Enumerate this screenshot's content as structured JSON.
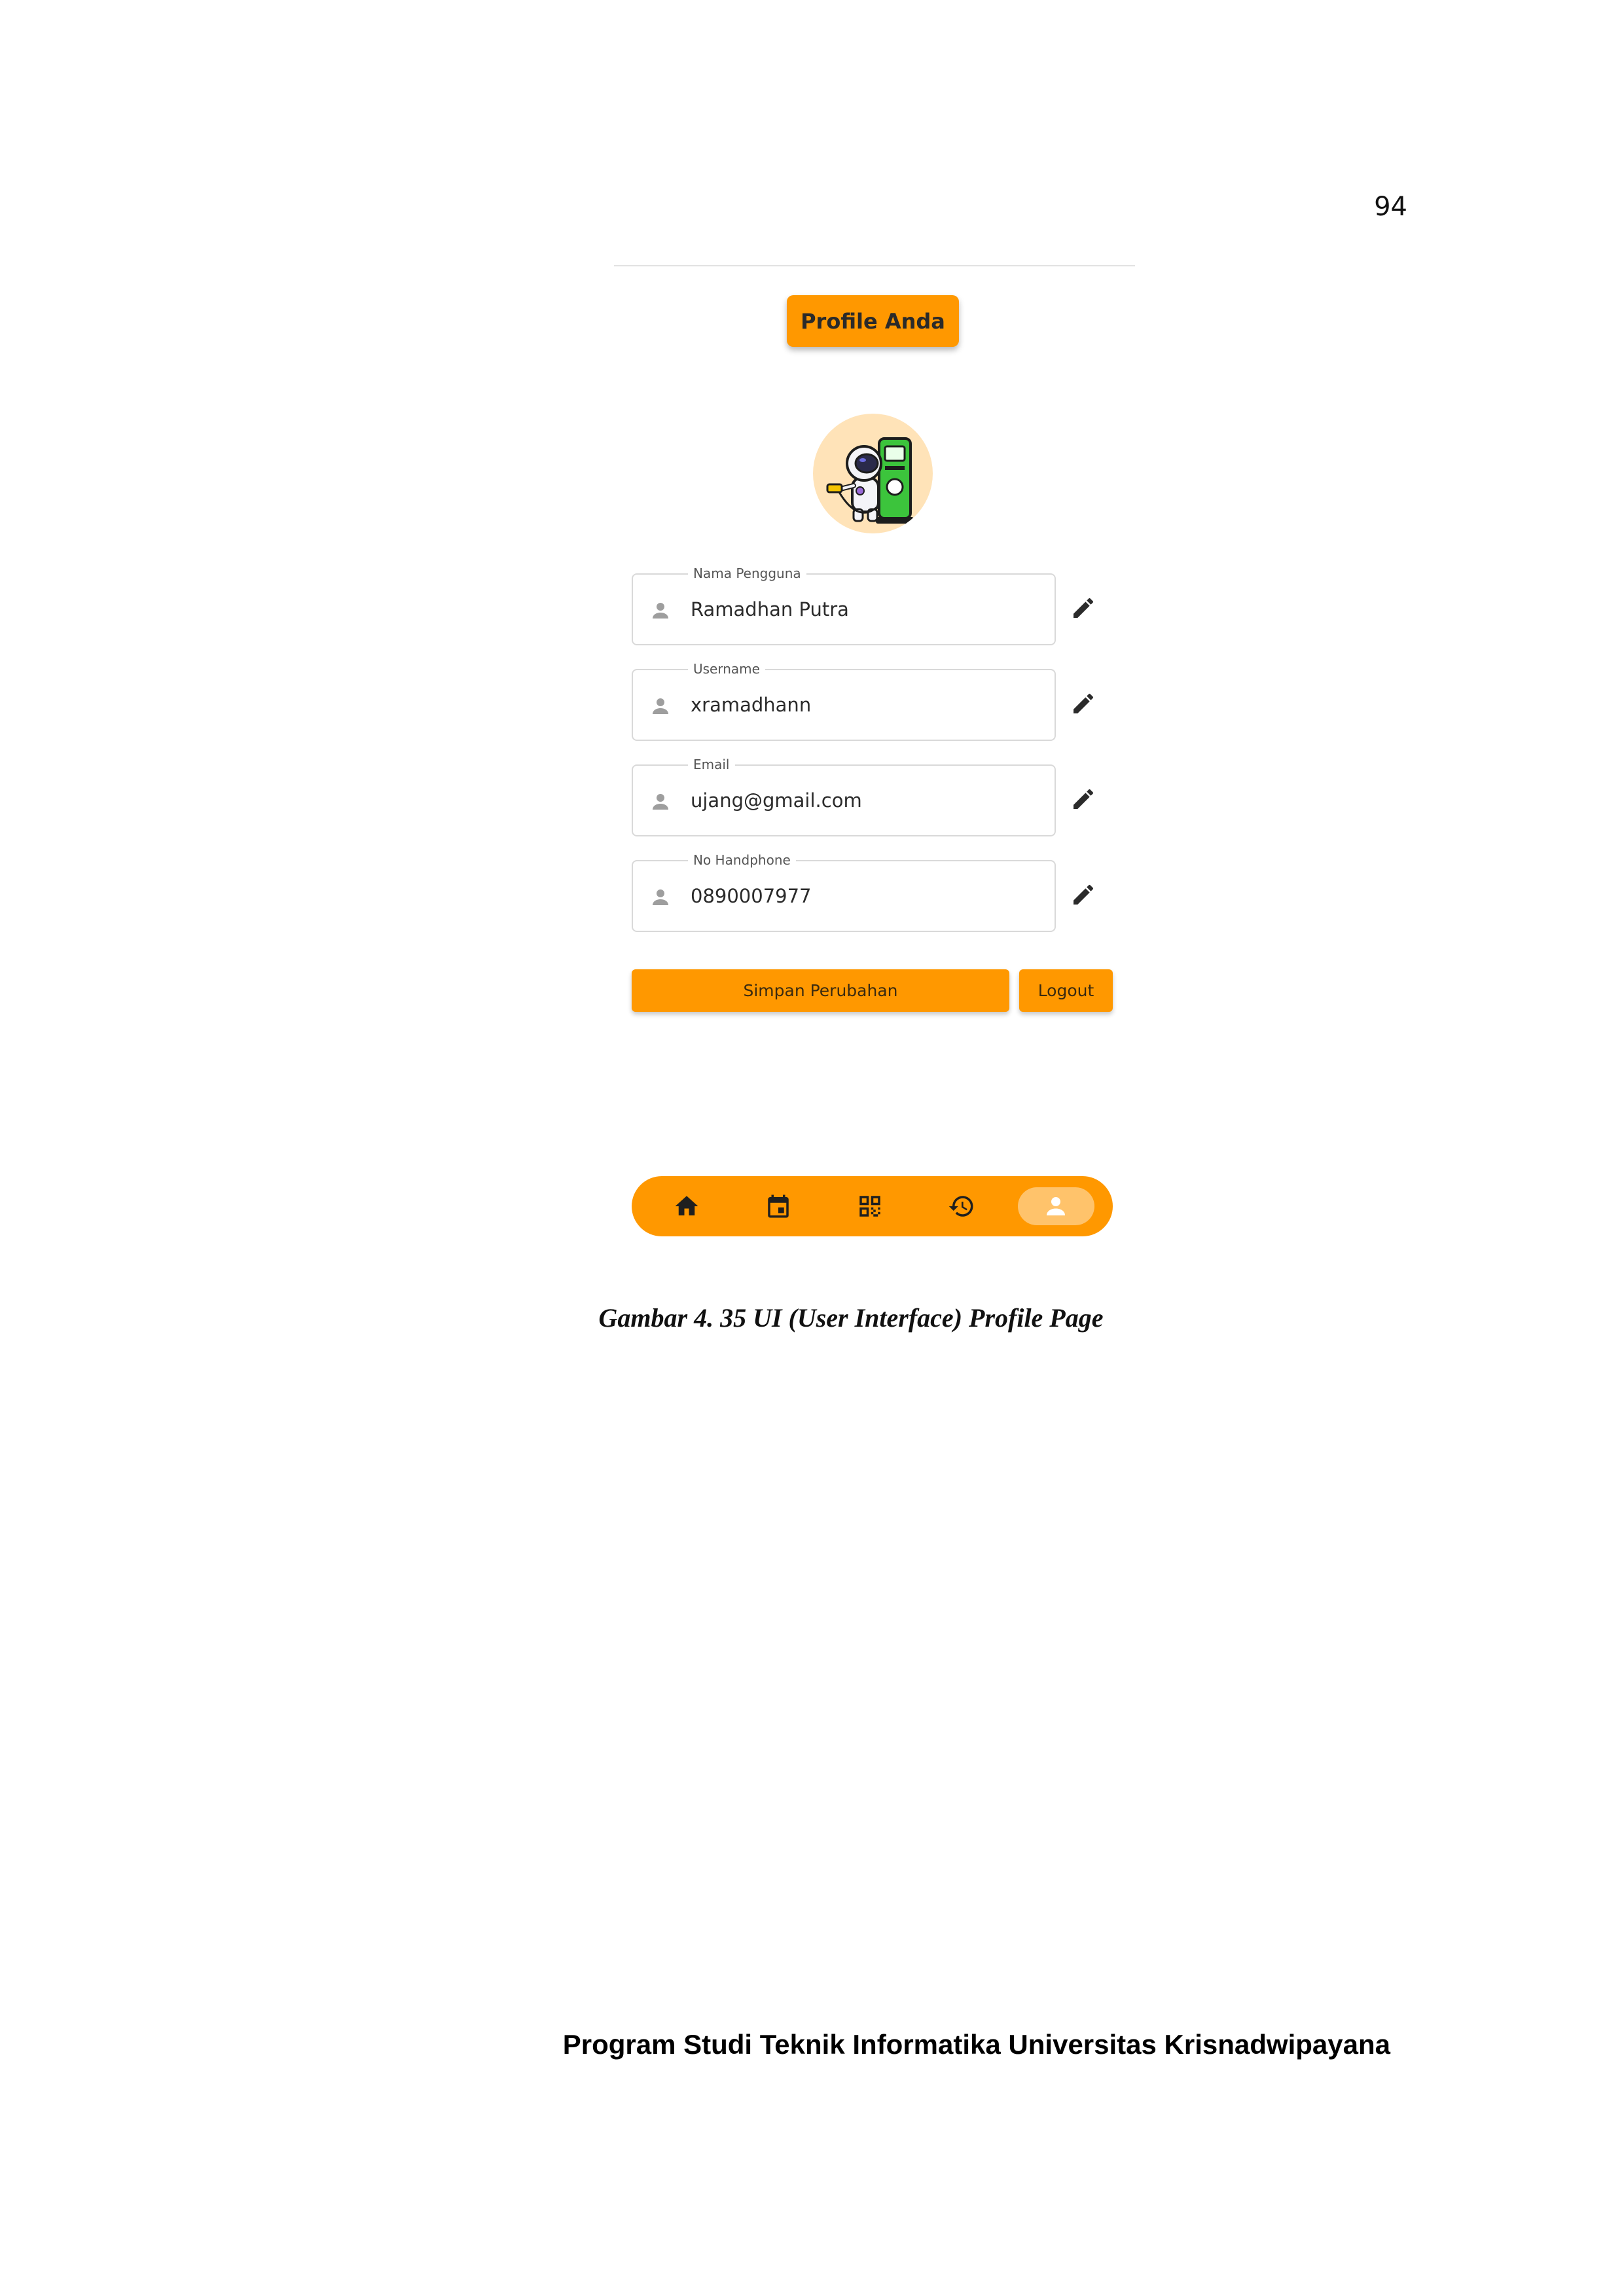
{
  "page_number": "94",
  "app": {
    "title_button": "Profile Anda",
    "avatar_icon": "astronaut-fuel-pump-illustration",
    "fields": [
      {
        "label": "Nama Pengguna",
        "value": "Ramadhan Putra",
        "icon": "person-icon",
        "edit_icon": "pencil-icon"
      },
      {
        "label": "Username",
        "value": "xramadhann",
        "icon": "person-icon",
        "edit_icon": "pencil-icon"
      },
      {
        "label": "Email",
        "value": "ujang@gmail.com",
        "icon": "person-icon",
        "edit_icon": "pencil-icon"
      },
      {
        "label": "No Handphone",
        "value": "0890007977",
        "icon": "person-icon",
        "edit_icon": "pencil-icon"
      }
    ],
    "save_button": "Simpan Perubahan",
    "logout_button": "Logout",
    "bottom_nav": {
      "items": [
        "home-icon",
        "calendar-icon",
        "qr-code-icon",
        "history-icon",
        "person-icon"
      ],
      "active_index": 4
    },
    "colors": {
      "accent": "#ff9800",
      "active_pill": "#ffc36b",
      "avatar_bg": "#ffe3b8"
    }
  },
  "caption": "Gambar 4. 35 UI (User Interface) Profile Page",
  "footer": "Program Studi Teknik Informatika Universitas Krisnadwipayana"
}
